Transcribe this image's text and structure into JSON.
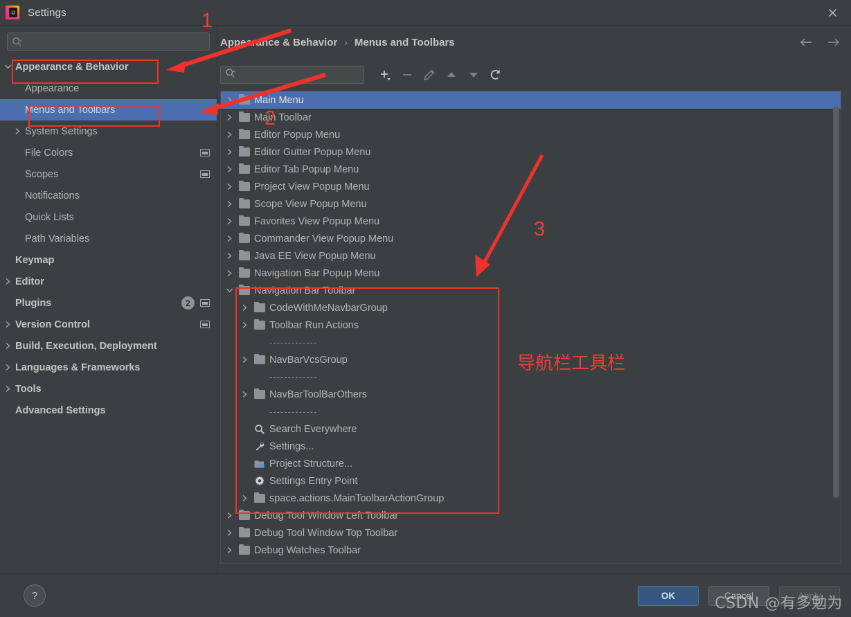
{
  "window": {
    "title": "Settings",
    "logo_icon": "intellij-idea-logo-icon",
    "close_icon": "close-icon"
  },
  "colors": {
    "background": "#3c3f41",
    "selection": "#4b6eaf",
    "primary_button": "#365880",
    "annotation_red": "#f0322c",
    "text": "#b4b4b4"
  },
  "left_panel": {
    "search": {
      "value": "",
      "placeholder": "",
      "icon": "search-icon"
    },
    "items": [
      {
        "label": "Appearance & Behavior",
        "twisty": "expanded",
        "indent": 0,
        "bold": true,
        "selected": false,
        "badge": null,
        "config_icon": false
      },
      {
        "label": "Appearance",
        "twisty": "none",
        "indent": 1,
        "bold": false,
        "selected": false,
        "badge": null,
        "config_icon": false
      },
      {
        "label": "Menus and Toolbars",
        "twisty": "none",
        "indent": 1,
        "bold": false,
        "selected": true,
        "badge": null,
        "config_icon": false
      },
      {
        "label": "System Settings",
        "twisty": "collapsed",
        "indent": 1,
        "bold": false,
        "selected": false,
        "badge": null,
        "config_icon": false
      },
      {
        "label": "File Colors",
        "twisty": "none",
        "indent": 1,
        "bold": false,
        "selected": false,
        "badge": null,
        "config_icon": true
      },
      {
        "label": "Scopes",
        "twisty": "none",
        "indent": 1,
        "bold": false,
        "selected": false,
        "badge": null,
        "config_icon": true
      },
      {
        "label": "Notifications",
        "twisty": "none",
        "indent": 1,
        "bold": false,
        "selected": false,
        "badge": null,
        "config_icon": false
      },
      {
        "label": "Quick Lists",
        "twisty": "none",
        "indent": 1,
        "bold": false,
        "selected": false,
        "badge": null,
        "config_icon": false
      },
      {
        "label": "Path Variables",
        "twisty": "none",
        "indent": 1,
        "bold": false,
        "selected": false,
        "badge": null,
        "config_icon": false
      },
      {
        "label": "Keymap",
        "twisty": "none",
        "indent": 0,
        "bold": true,
        "selected": false,
        "badge": null,
        "config_icon": false
      },
      {
        "label": "Editor",
        "twisty": "collapsed",
        "indent": 0,
        "bold": true,
        "selected": false,
        "badge": null,
        "config_icon": false
      },
      {
        "label": "Plugins",
        "twisty": "none",
        "indent": 0,
        "bold": true,
        "selected": false,
        "badge": "2",
        "config_icon": true
      },
      {
        "label": "Version Control",
        "twisty": "collapsed",
        "indent": 0,
        "bold": true,
        "selected": false,
        "badge": null,
        "config_icon": true
      },
      {
        "label": "Build, Execution, Deployment",
        "twisty": "collapsed",
        "indent": 0,
        "bold": true,
        "selected": false,
        "badge": null,
        "config_icon": false
      },
      {
        "label": "Languages & Frameworks",
        "twisty": "collapsed",
        "indent": 0,
        "bold": true,
        "selected": false,
        "badge": null,
        "config_icon": false
      },
      {
        "label": "Tools",
        "twisty": "collapsed",
        "indent": 0,
        "bold": true,
        "selected": false,
        "badge": null,
        "config_icon": false
      },
      {
        "label": "Advanced Settings",
        "twisty": "none",
        "indent": 0,
        "bold": true,
        "selected": false,
        "badge": null,
        "config_icon": false
      }
    ]
  },
  "breadcrumb": {
    "root": "Appearance & Behavior",
    "separator": "›",
    "leaf": "Menus and Toolbars",
    "back_icon": "arrow-left-icon",
    "forward_icon": "arrow-right-icon"
  },
  "toolbar": {
    "search": {
      "value": "",
      "placeholder": "",
      "icon": "search-icon"
    },
    "buttons": [
      {
        "name": "add-button",
        "icon": "plus-dropdown-icon",
        "enabled": true
      },
      {
        "name": "remove-button",
        "icon": "minus-icon",
        "enabled": false
      },
      {
        "name": "edit-button",
        "icon": "pencil-icon",
        "enabled": false
      },
      {
        "name": "move-up-button",
        "icon": "caret-up-icon",
        "enabled": false
      },
      {
        "name": "move-down-button",
        "icon": "caret-down-icon",
        "enabled": false
      },
      {
        "name": "restore-button",
        "icon": "restore-arrow-icon",
        "enabled": true
      }
    ]
  },
  "tree": {
    "rows": [
      {
        "label": "Main Menu",
        "icon": "folder-icon",
        "twisty": "collapsed",
        "indent": 0,
        "selected": true,
        "type": "node"
      },
      {
        "label": "Main Toolbar",
        "icon": "folder-icon",
        "twisty": "collapsed",
        "indent": 0,
        "selected": false,
        "type": "node"
      },
      {
        "label": "Editor Popup Menu",
        "icon": "folder-icon",
        "twisty": "collapsed",
        "indent": 0,
        "selected": false,
        "type": "node"
      },
      {
        "label": "Editor Gutter Popup Menu",
        "icon": "folder-icon",
        "twisty": "collapsed",
        "indent": 0,
        "selected": false,
        "type": "node"
      },
      {
        "label": "Editor Tab Popup Menu",
        "icon": "folder-icon",
        "twisty": "collapsed",
        "indent": 0,
        "selected": false,
        "type": "node"
      },
      {
        "label": "Project View Popup Menu",
        "icon": "folder-icon",
        "twisty": "collapsed",
        "indent": 0,
        "selected": false,
        "type": "node"
      },
      {
        "label": "Scope View Popup Menu",
        "icon": "folder-icon",
        "twisty": "collapsed",
        "indent": 0,
        "selected": false,
        "type": "node"
      },
      {
        "label": "Favorites View Popup Menu",
        "icon": "folder-icon",
        "twisty": "collapsed",
        "indent": 0,
        "selected": false,
        "type": "node"
      },
      {
        "label": "Commander View Popup Menu",
        "icon": "folder-icon",
        "twisty": "collapsed",
        "indent": 0,
        "selected": false,
        "type": "node"
      },
      {
        "label": "Java EE View Popup Menu",
        "icon": "folder-icon",
        "twisty": "collapsed",
        "indent": 0,
        "selected": false,
        "type": "node"
      },
      {
        "label": "Navigation Bar Popup Menu",
        "icon": "folder-icon",
        "twisty": "collapsed",
        "indent": 0,
        "selected": false,
        "type": "node"
      },
      {
        "label": "Navigation Bar Toolbar",
        "icon": "folder-icon",
        "twisty": "expanded",
        "indent": 0,
        "selected": false,
        "type": "node"
      },
      {
        "label": "CodeWithMeNavbarGroup",
        "icon": "folder-icon",
        "twisty": "collapsed",
        "indent": 1,
        "selected": false,
        "type": "node"
      },
      {
        "label": "Toolbar Run Actions",
        "icon": "folder-icon",
        "twisty": "collapsed",
        "indent": 1,
        "selected": false,
        "type": "node"
      },
      {
        "label": "-------------",
        "icon": "none",
        "twisty": "none",
        "indent": 1,
        "selected": false,
        "type": "separator"
      },
      {
        "label": "NavBarVcsGroup",
        "icon": "folder-icon",
        "twisty": "collapsed",
        "indent": 1,
        "selected": false,
        "type": "node"
      },
      {
        "label": "-------------",
        "icon": "none",
        "twisty": "none",
        "indent": 1,
        "selected": false,
        "type": "separator"
      },
      {
        "label": "NavBarToolBarOthers",
        "icon": "folder-icon",
        "twisty": "collapsed",
        "indent": 1,
        "selected": false,
        "type": "node"
      },
      {
        "label": "-------------",
        "icon": "none",
        "twisty": "none",
        "indent": 1,
        "selected": false,
        "type": "separator"
      },
      {
        "label": "Search Everywhere",
        "icon": "magnifier-icon",
        "twisty": "none",
        "indent": 1,
        "selected": false,
        "type": "action"
      },
      {
        "label": "Settings...",
        "icon": "wrench-icon",
        "twisty": "none",
        "indent": 1,
        "selected": false,
        "type": "action"
      },
      {
        "label": "Project Structure...",
        "icon": "project-structure-icon",
        "twisty": "none",
        "indent": 1,
        "selected": false,
        "type": "action"
      },
      {
        "label": "Settings Entry Point",
        "icon": "gear-icon",
        "twisty": "none",
        "indent": 1,
        "selected": false,
        "type": "action"
      },
      {
        "label": "space.actions.MainToolbarActionGroup",
        "icon": "folder-icon",
        "twisty": "collapsed",
        "indent": 1,
        "selected": false,
        "type": "node"
      },
      {
        "label": "Debug Tool Window Left Toolbar",
        "icon": "folder-icon",
        "twisty": "collapsed",
        "indent": 0,
        "selected": false,
        "type": "node"
      },
      {
        "label": "Debug Tool Window Top Toolbar",
        "icon": "folder-icon",
        "twisty": "collapsed",
        "indent": 0,
        "selected": false,
        "type": "node"
      },
      {
        "label": "Debug Watches Toolbar",
        "icon": "folder-icon",
        "twisty": "collapsed",
        "indent": 0,
        "selected": false,
        "type": "node"
      }
    ]
  },
  "footer": {
    "help_label": "?",
    "ok_label": "OK",
    "cancel_label": "Cancel",
    "apply_label": "Apply"
  },
  "annotations": {
    "num1": "1",
    "num2": "2",
    "num3": "3",
    "chinese_label": "导航栏工具栏",
    "watermark": "CSDN @有多勉为"
  }
}
